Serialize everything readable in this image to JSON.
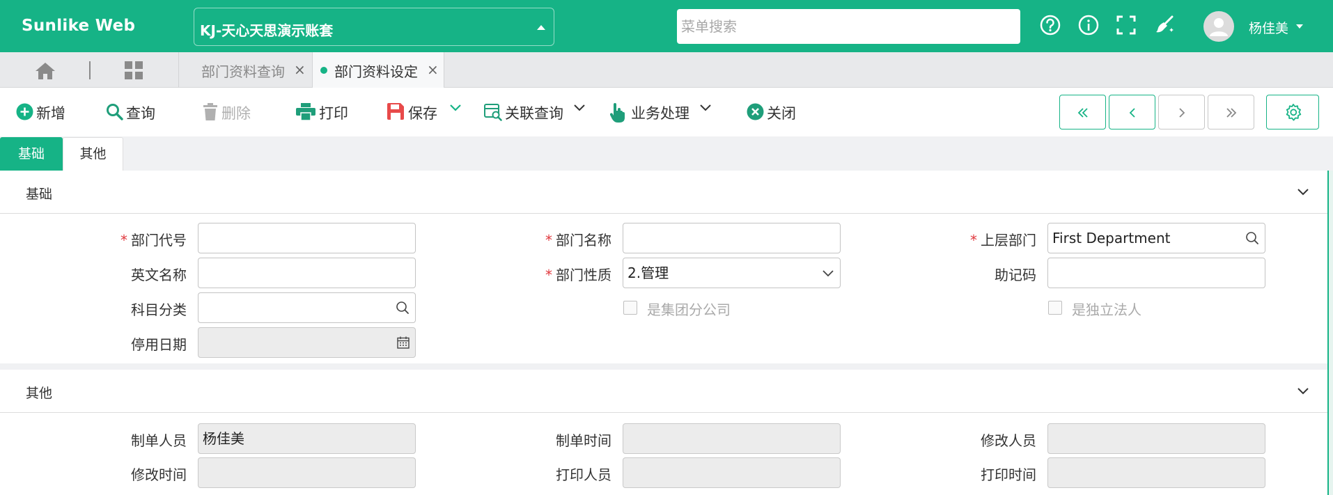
{
  "app": {
    "brand": "Sunlike Web",
    "account": "KJ-天心天思演示账套",
    "menu_search_placeholder": "菜单搜索",
    "user_name": "杨佳美"
  },
  "tabs": [
    {
      "label": "部门资料查询",
      "close": "×",
      "active": false
    },
    {
      "label": "部门资料设定",
      "close": "×",
      "active": true
    }
  ],
  "toolbar": {
    "add": "新增",
    "query": "查询",
    "delete": "删除",
    "print": "打印",
    "save": "保存",
    "related_query": "关联查询",
    "business": "业务处理",
    "close": "关闭"
  },
  "subtabs": [
    "基础",
    "其他"
  ],
  "sections": {
    "basic": {
      "title": "基础",
      "dept_code_label": "部门代号",
      "dept_code_value": "",
      "dept_name_label": "部门名称",
      "dept_name_value": "",
      "parent_dept_label": "上层部门",
      "parent_dept_value": "First Department",
      "english_name_label": "英文名称",
      "english_name_value": "",
      "dept_nature_label": "部门性质",
      "dept_nature_value": "2.管理",
      "mnemonic_label": "助记码",
      "mnemonic_value": "",
      "subject_class_label": "科目分类",
      "subject_class_value": "",
      "group_branch_label": "是集团分公司",
      "group_branch_checked": false,
      "independent_legal_label": "是独立法人",
      "independent_legal_checked": false,
      "disable_date_label": "停用日期",
      "disable_date_value": ""
    },
    "other": {
      "title": "其他",
      "creator_label": "制单人员",
      "creator_value": "杨佳美",
      "create_time_label": "制单时间",
      "create_time_value": "",
      "modifier_label": "修改人员",
      "modifier_value": "",
      "modify_time_label": "修改时间",
      "modify_time_value": "",
      "printer_label": "打印人员",
      "printer_value": "",
      "print_time_label": "打印时间",
      "print_time_value": ""
    }
  },
  "colors": {
    "brand": "#16b386",
    "required": "#e0393e",
    "save_icon": "#e84a4a",
    "print_icon": "#1f9e7a"
  }
}
